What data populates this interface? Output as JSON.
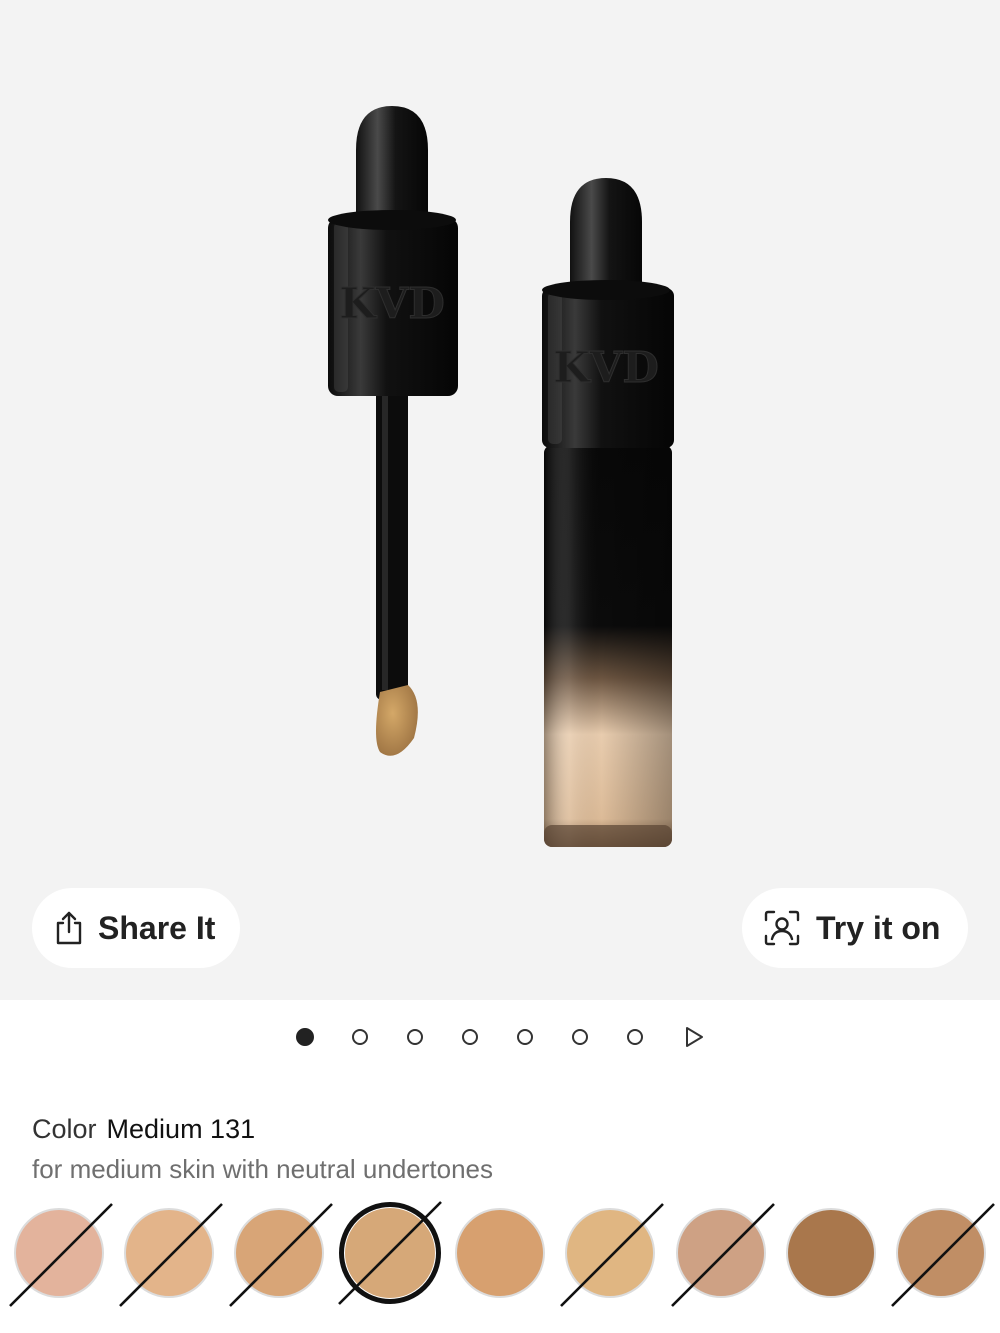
{
  "product": {
    "image_alt": "KVD concealer dropper and bottle",
    "logo_text": "KVD"
  },
  "actions": {
    "share_label": "Share It",
    "tryon_label": "Try it on",
    "share_icon": "share-icon",
    "tryon_icon": "face-scan-icon"
  },
  "carousel": {
    "count": 7,
    "active_index": 0,
    "play_icon": "play-icon"
  },
  "color": {
    "prefix": "Color",
    "value": "Medium 131",
    "description": "for medium skin with neutral undertones"
  },
  "swatches": [
    {
      "color": "#e3b39c",
      "unavailable": true,
      "selected": false
    },
    {
      "color": "#e3b48a",
      "unavailable": true,
      "selected": false
    },
    {
      "color": "#d8a577",
      "unavailable": true,
      "selected": false
    },
    {
      "color": "#d6a878",
      "unavailable": true,
      "selected": true
    },
    {
      "color": "#d7a06f",
      "unavailable": false,
      "selected": false
    },
    {
      "color": "#e0b682",
      "unavailable": true,
      "selected": false
    },
    {
      "color": "#cea184",
      "unavailable": true,
      "selected": false
    },
    {
      "color": "#a9774c",
      "unavailable": false,
      "selected": false
    },
    {
      "color": "#c08e65",
      "unavailable": true,
      "selected": false
    }
  ]
}
